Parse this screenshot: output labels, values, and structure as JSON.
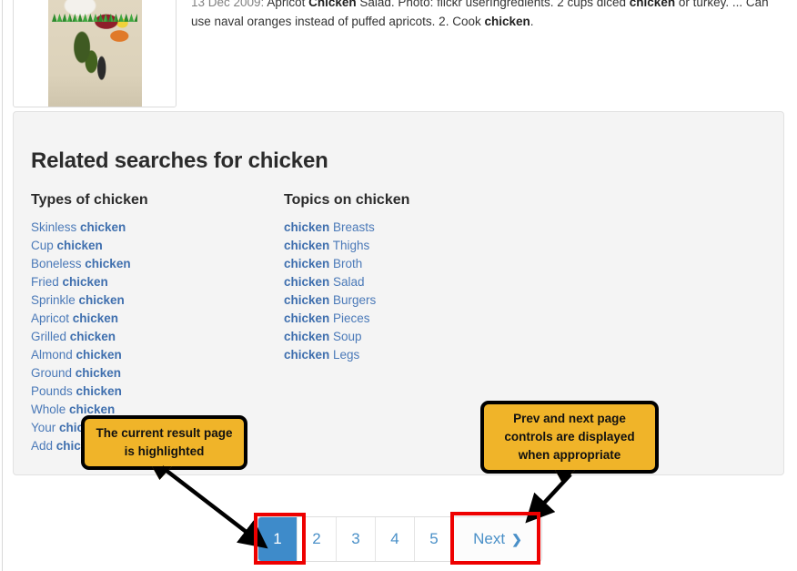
{
  "result": {
    "snippet_date": "13 Dec 2009:",
    "snippet_line1_a": " Apricot ",
    "snippet_bold1": "Chicken",
    "snippet_line1_b": " Salad. Photo: flickr userIngredients. 2 cups diced ",
    "snippet_bold2": "chicken",
    "snippet_line1_c": " or turkey. ... Can use naval oranges instead of puffed apricots. 2. Cook ",
    "snippet_bold3": "chicken",
    "snippet_line1_d": ".",
    "thumbnail_alt": "bento-box-photo"
  },
  "related": {
    "title_prefix": "Related searches for ",
    "title_term": "chicken",
    "left_column": {
      "heading_prefix": "Types of ",
      "heading_term": "chicken",
      "items": [
        {
          "prefix": "Skinless ",
          "term": "chicken",
          "suffix": ""
        },
        {
          "prefix": "Cup ",
          "term": "chicken",
          "suffix": ""
        },
        {
          "prefix": "Boneless ",
          "term": "chicken",
          "suffix": ""
        },
        {
          "prefix": "Fried ",
          "term": "chicken",
          "suffix": ""
        },
        {
          "prefix": "Sprinkle ",
          "term": "chicken",
          "suffix": ""
        },
        {
          "prefix": "Apricot ",
          "term": "chicken",
          "suffix": ""
        },
        {
          "prefix": "Grilled ",
          "term": "chicken",
          "suffix": ""
        },
        {
          "prefix": "Almond ",
          "term": "chicken",
          "suffix": ""
        },
        {
          "prefix": "Ground ",
          "term": "chicken",
          "suffix": ""
        },
        {
          "prefix": "Pounds ",
          "term": "chicken",
          "suffix": ""
        },
        {
          "prefix": "Whole ",
          "term": "chicken",
          "suffix": ""
        },
        {
          "prefix": "Your ",
          "term": "chicken",
          "suffix": ""
        },
        {
          "prefix": "Add ",
          "term": "chicken",
          "suffix": ""
        }
      ]
    },
    "right_column": {
      "heading_prefix": "Topics on ",
      "heading_term": "chicken",
      "items": [
        {
          "prefix": "",
          "term": "chicken",
          "suffix": " Breasts"
        },
        {
          "prefix": "",
          "term": "chicken",
          "suffix": " Thighs"
        },
        {
          "prefix": "",
          "term": "chicken",
          "suffix": " Broth"
        },
        {
          "prefix": "",
          "term": "chicken",
          "suffix": " Salad"
        },
        {
          "prefix": "",
          "term": "chicken",
          "suffix": " Burgers"
        },
        {
          "prefix": "",
          "term": "chicken",
          "suffix": " Pieces"
        },
        {
          "prefix": "",
          "term": "chicken",
          "suffix": " Soup"
        },
        {
          "prefix": "",
          "term": "chicken",
          "suffix": " Legs"
        }
      ]
    }
  },
  "pagination": {
    "pages": [
      "1",
      "2",
      "3",
      "4",
      "5"
    ],
    "active_page": "1",
    "next_label": "Next",
    "next_chevron": "❯",
    "active_color": "#3e8bca",
    "link_color": "#4a90c8"
  },
  "annotations": {
    "callout_1": "The current result page is highlighted",
    "callout_2": "Prev and next page controls are displayed when appropriate",
    "highlight_color": "#ee0000",
    "callout_fill": "#f0b429"
  }
}
